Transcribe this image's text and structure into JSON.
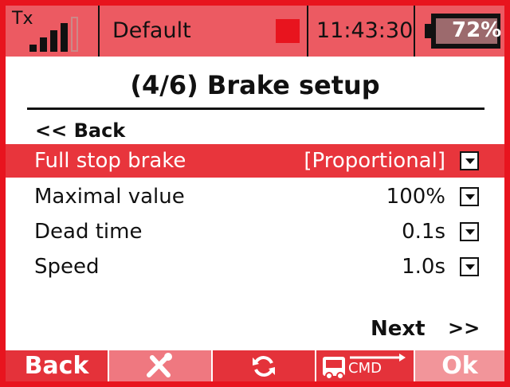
{
  "status_bar": {
    "tx_label": "Tx",
    "signal_bars": 4,
    "model_name": "Default",
    "time": "11:43:30",
    "battery_percent": "72%"
  },
  "screen": {
    "title": "(4/6) Brake setup",
    "back_link": "<< Back"
  },
  "settings": [
    {
      "label": "Full stop brake",
      "value": "[Proportional]"
    },
    {
      "label": "Maximal value",
      "value": "100%"
    },
    {
      "label": "Dead time",
      "value": "0.1s"
    },
    {
      "label": "Speed",
      "value": "1.0s"
    }
  ],
  "nav": {
    "next_label": "Next",
    "next_arrow": ">>"
  },
  "softkeys": {
    "back": "Back",
    "tools_icon": "wrench-screwdriver-icon",
    "refresh_icon": "refresh-icon",
    "cmd_icon": "transmitter-cmd-icon",
    "cmd_text": "CMD",
    "ok": "Ok"
  },
  "colors": {
    "accent": "#e8141e",
    "selected_row": "#e8353c",
    "status_bar": "#ec5a62"
  }
}
